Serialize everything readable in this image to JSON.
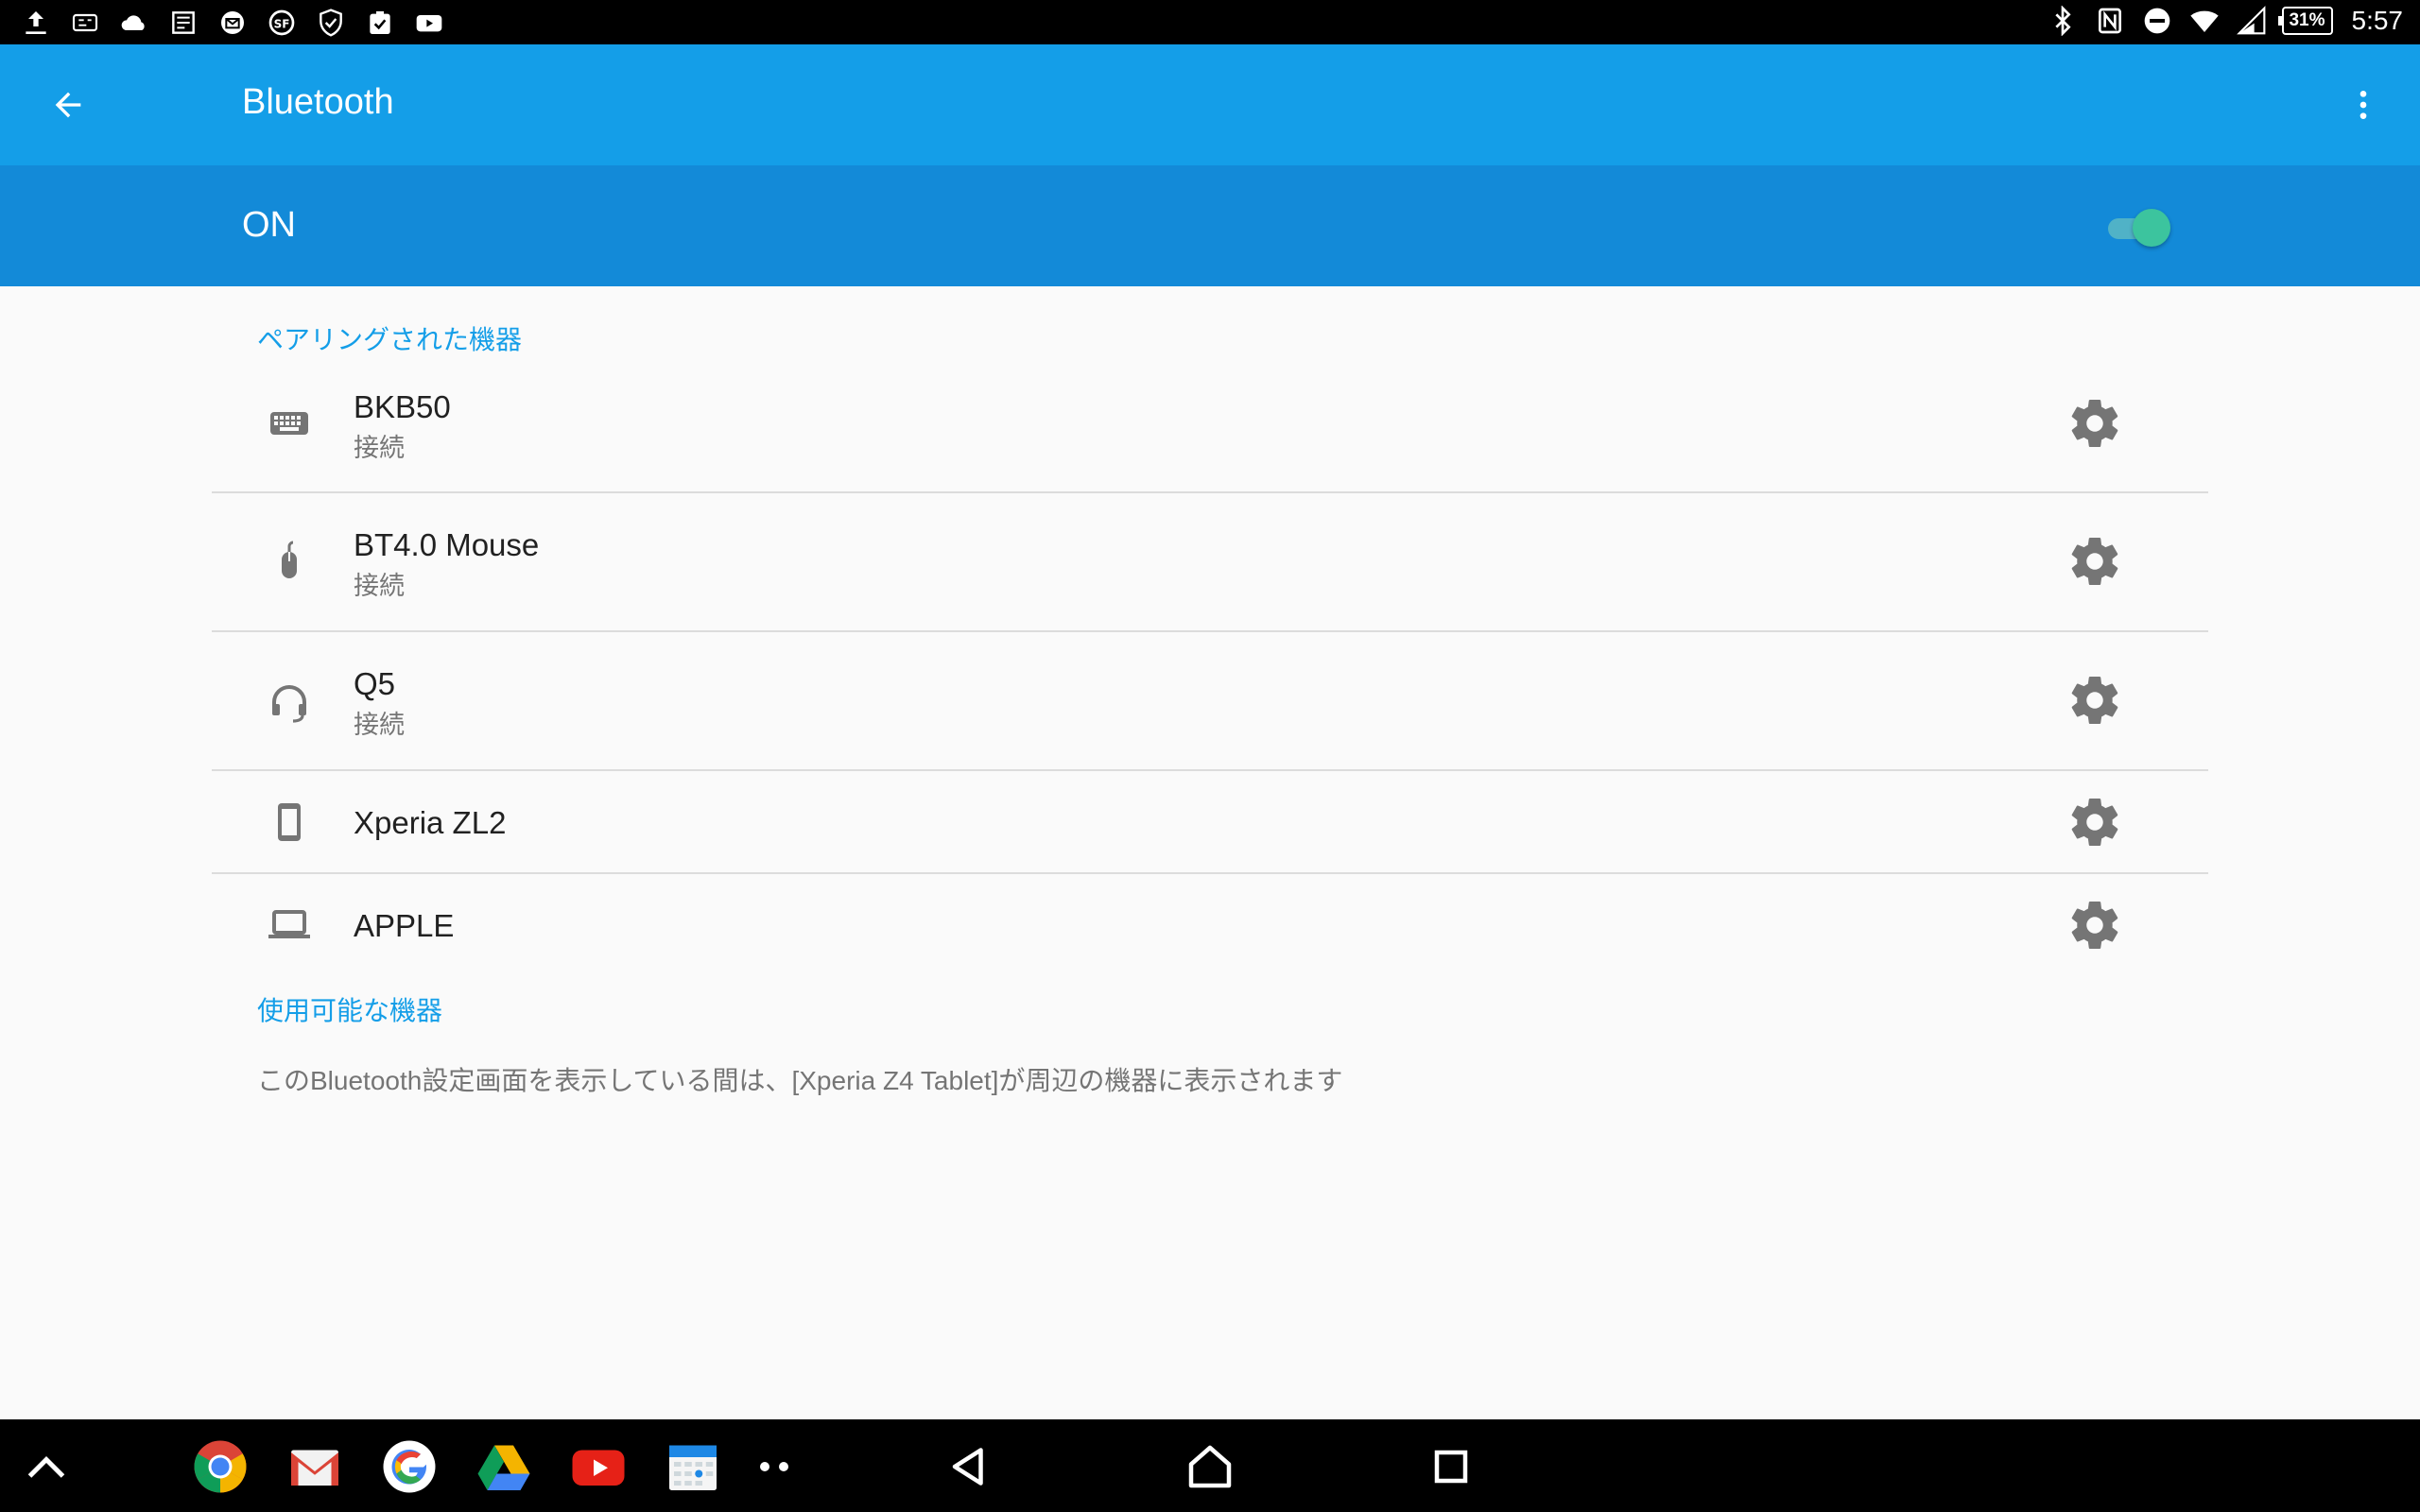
{
  "status_bar": {
    "left_icons": [
      "upload-icon",
      "caption-icon",
      "cloud-icon",
      "news-icon",
      "mail-badge-icon",
      "sf-icon",
      "shield-check-icon",
      "clipboard-check-icon",
      "youtube-icon"
    ],
    "right_icons": [
      "bluetooth-icon",
      "nfc-icon",
      "do-not-disturb-icon",
      "wifi-icon",
      "signal-icon"
    ],
    "battery": "31%",
    "clock": "5:57"
  },
  "app_bar": {
    "title": "Bluetooth"
  },
  "switch_bar": {
    "label": "ON",
    "enabled": true
  },
  "paired_section": {
    "header": "ペアリングされた機器",
    "devices": [
      {
        "name": "BKB50",
        "status": "接続",
        "icon": "keyboard-icon"
      },
      {
        "name": "BT4.0 Mouse",
        "status": "接続",
        "icon": "mouse-icon"
      },
      {
        "name": "Q5",
        "status": "接続",
        "icon": "headset-icon"
      },
      {
        "name": "Xperia ZL2",
        "status": "",
        "icon": "phone-icon"
      },
      {
        "name": "APPLE",
        "status": "",
        "icon": "laptop-icon"
      }
    ]
  },
  "available_section": {
    "header": "使用可能な機器",
    "note": "このBluetooth設定画面を表示している間は、[Xperia Z4 Tablet]が周辺の機器に表示されます"
  },
  "nav_bar": {
    "apps": [
      "chrome-icon",
      "gmail-icon",
      "google-icon",
      "drive-icon",
      "youtube-icon",
      "calendar-icon"
    ]
  },
  "colors": {
    "app_bar": "#149ee8",
    "switch_bar": "#138ad8",
    "accent": "#149ee8",
    "toggle_thumb": "#3cc49e"
  }
}
